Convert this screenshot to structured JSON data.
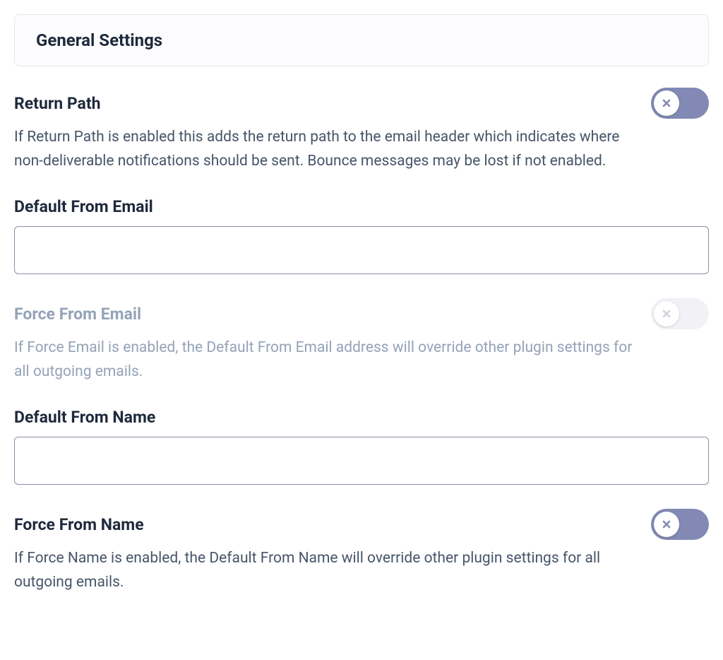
{
  "panel": {
    "title": "General Settings"
  },
  "settings": {
    "return_path": {
      "label": "Return Path",
      "description": "If Return Path is enabled this adds the return path to the email header which indicates where non-deliverable notifications should be sent. Bounce messages may be lost if not enabled.",
      "enabled": false,
      "state": "active"
    },
    "default_from_email": {
      "label": "Default From Email",
      "value": ""
    },
    "force_from_email": {
      "label": "Force From Email",
      "description": "If Force Email is enabled, the Default From Email address will override other plugin settings for all outgoing emails.",
      "enabled": false,
      "state": "disabled"
    },
    "default_from_name": {
      "label": "Default From Name",
      "value": ""
    },
    "force_from_name": {
      "label": "Force From Name",
      "description": "If Force Name is enabled, the Default From Name will override other plugin settings for all outgoing emails.",
      "enabled": false,
      "state": "active"
    }
  }
}
